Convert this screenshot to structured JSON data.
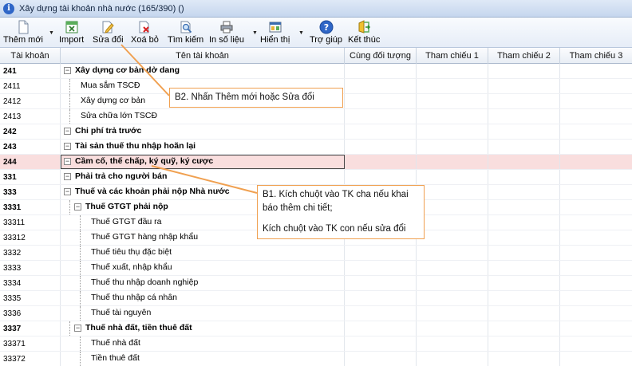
{
  "window": {
    "title": "Xây dựng tài khoản nhà nước (165/390) ()"
  },
  "toolbar": {
    "new_label": "Thêm mới",
    "import_label": "Import",
    "edit_label": "Sửa đổi",
    "delete_label": "Xoá bỏ",
    "search_label": "Tìm kiếm",
    "print_label": "In số liệu",
    "view_label": "Hiển thị",
    "help_label": "Trợ giúp",
    "exit_label": "Kết thúc"
  },
  "table": {
    "columns": [
      "Tài khoản",
      "Tên tài khoản",
      "Cùng đối tượng",
      "Tham chiếu 1",
      "Tham chiếu 2",
      "Tham chiếu 3"
    ],
    "rows": [
      {
        "code": "241",
        "name": "Xây dựng cơ bản dở dang",
        "level": 0,
        "bold": true,
        "expander": "−"
      },
      {
        "code": "2411",
        "name": "Mua sắm TSCĐ",
        "level": 1,
        "bold": false,
        "expander": ""
      },
      {
        "code": "2412",
        "name": "Xây dựng cơ bản",
        "level": 1,
        "bold": false,
        "expander": ""
      },
      {
        "code": "2413",
        "name": "Sửa chữa lớn TSCĐ",
        "level": 1,
        "bold": false,
        "expander": ""
      },
      {
        "code": "242",
        "name": "Chi phí trả trước",
        "level": 0,
        "bold": true,
        "expander": "−"
      },
      {
        "code": "243",
        "name": "Tài sản thuế thu nhập hoãn lại",
        "level": 0,
        "bold": true,
        "expander": "−"
      },
      {
        "code": "244",
        "name": "Cầm cố, thế chấp, ký quỹ, ký cược",
        "level": 0,
        "bold": true,
        "expander": "−",
        "selected": true
      },
      {
        "code": "331",
        "name": "Phải trả cho người bán",
        "level": 0,
        "bold": true,
        "expander": "−"
      },
      {
        "code": "333",
        "name": "Thuế và các khoản phải nộp Nhà nước",
        "level": 0,
        "bold": true,
        "expander": "−"
      },
      {
        "code": "3331",
        "name": "Thuế GTGT phải nộp",
        "level": 1,
        "bold": true,
        "expander": "−"
      },
      {
        "code": "33311",
        "name": "Thuế GTGT đầu ra",
        "level": 2,
        "bold": false,
        "expander": ""
      },
      {
        "code": "33312",
        "name": "Thuế GTGT hàng nhập khẩu",
        "level": 2,
        "bold": false,
        "expander": ""
      },
      {
        "code": "3332",
        "name": "Thuế tiêu thụ đặc biệt",
        "level": 2,
        "bold": false,
        "expander": ""
      },
      {
        "code": "3333",
        "name": "Thuế xuất, nhập khẩu",
        "level": 2,
        "bold": false,
        "expander": ""
      },
      {
        "code": "3334",
        "name": "Thuế thu nhập doanh nghiệp",
        "level": 2,
        "bold": false,
        "expander": ""
      },
      {
        "code": "3335",
        "name": "Thuế thu nhập cá nhân",
        "level": 2,
        "bold": false,
        "expander": ""
      },
      {
        "code": "3336",
        "name": "Thuế tài nguyên",
        "level": 2,
        "bold": false,
        "expander": ""
      },
      {
        "code": "3337",
        "name": "Thuế nhà đất, tiền thuê đất",
        "level": 1,
        "bold": true,
        "expander": "−"
      },
      {
        "code": "33371",
        "name": "Thuế nhà đất",
        "level": 2,
        "bold": false,
        "expander": ""
      },
      {
        "code": "33372",
        "name": "Tiền thuê đất",
        "level": 2,
        "bold": false,
        "expander": ""
      }
    ]
  },
  "annotations": {
    "step2": "B2. Nhấn Thêm mới hoặc Sửa đổi",
    "step1_line1": "B1. Kích chuột vào TK cha nếu khai",
    "step1_line2": "báo thêm chi tiết;",
    "step1_line3": "Kích chuột vào TK con nếu sửa đổi"
  },
  "colors": {
    "annotation_line": "#f0a050",
    "selected_row": "#f9dede",
    "help_icon": "#2f66c7"
  },
  "icons": [
    "info-icon",
    "new-doc-icon",
    "import-icon",
    "edit-icon",
    "delete-icon",
    "search-icon",
    "printer-icon",
    "view-icon",
    "help-icon",
    "exit-icon"
  ]
}
